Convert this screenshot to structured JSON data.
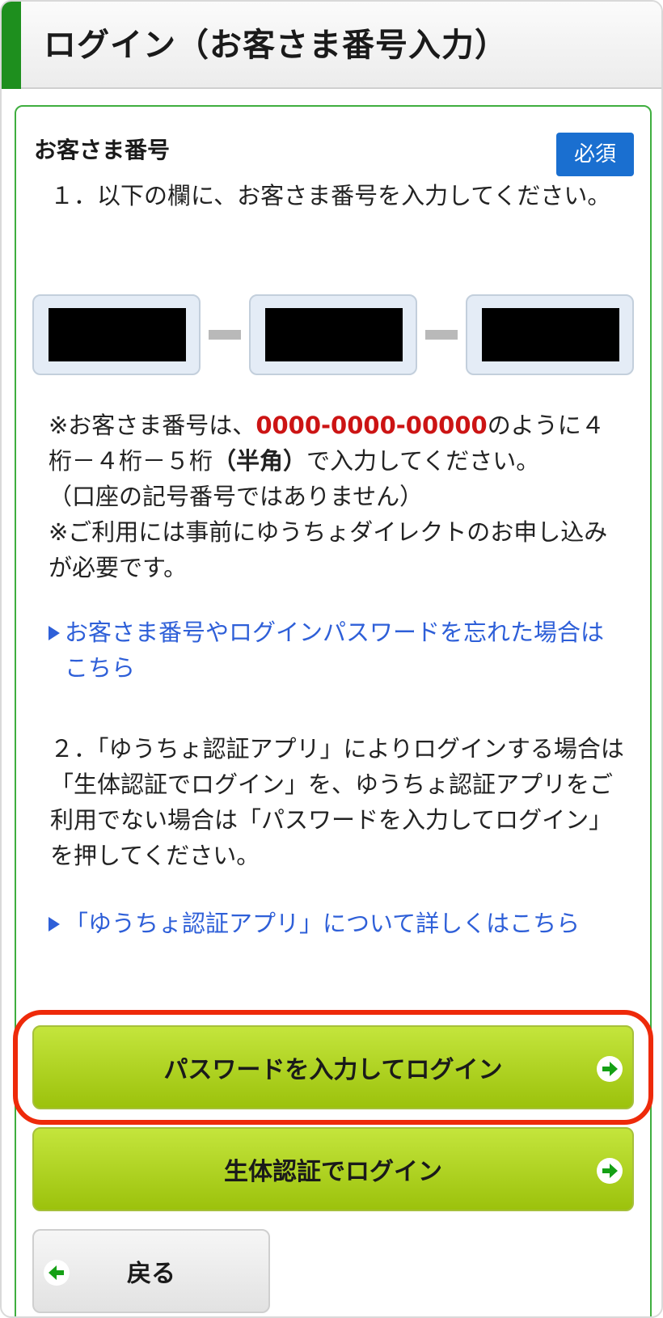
{
  "header": {
    "title": "ログイン（お客さま番号入力）"
  },
  "form": {
    "field_label": "お客さま番号",
    "required_badge": "必須",
    "instruction1": "１．以下の欄に、お客さま番号を入力してください。",
    "inputs": [
      {
        "value": ""
      },
      {
        "value": ""
      },
      {
        "value": ""
      }
    ]
  },
  "notes": {
    "line1_prefix": "※お客さま番号は、",
    "example_number": "0000-0000-00000",
    "line1_suffix": "のように４桁－４桁－５桁",
    "half_width": "（半角）",
    "line1_tail": "で入力してください。",
    "line2": "（口座の記号番号ではありません）",
    "line3": "※ご利用には事前にゆうちょダイレクトのお申し込みが必要です。"
  },
  "links": {
    "forgot": "お客さま番号やログインパスワードを忘れた場合はこちら",
    "auth_app": "「ゆうちょ認証アプリ」について詳しくはこちら"
  },
  "instruction2": "２．「ゆうちょ認証アプリ」によりログインする場合は「生体認証でログイン」を、ゆうちょ認証アプリをご利用でない場合は「パスワードを入力してログイン」を押してください。",
  "buttons": {
    "password_login": "パスワードを入力してログイン",
    "biometric_login": "生体認証でログイン",
    "back": "戻る"
  },
  "colors": {
    "header_accent": "#1e8f1e",
    "panel_border": "#3fae3f",
    "badge": "#1a6fd0",
    "link": "#2e5fd8",
    "example_number": "#cc1414",
    "button_green": "#a8cc1c",
    "highlight": "#ee2a0a"
  },
  "icons": {
    "next": "arrow-right-circle-icon",
    "back": "arrow-left-circle-icon",
    "link_marker": "triangle-right-icon"
  }
}
